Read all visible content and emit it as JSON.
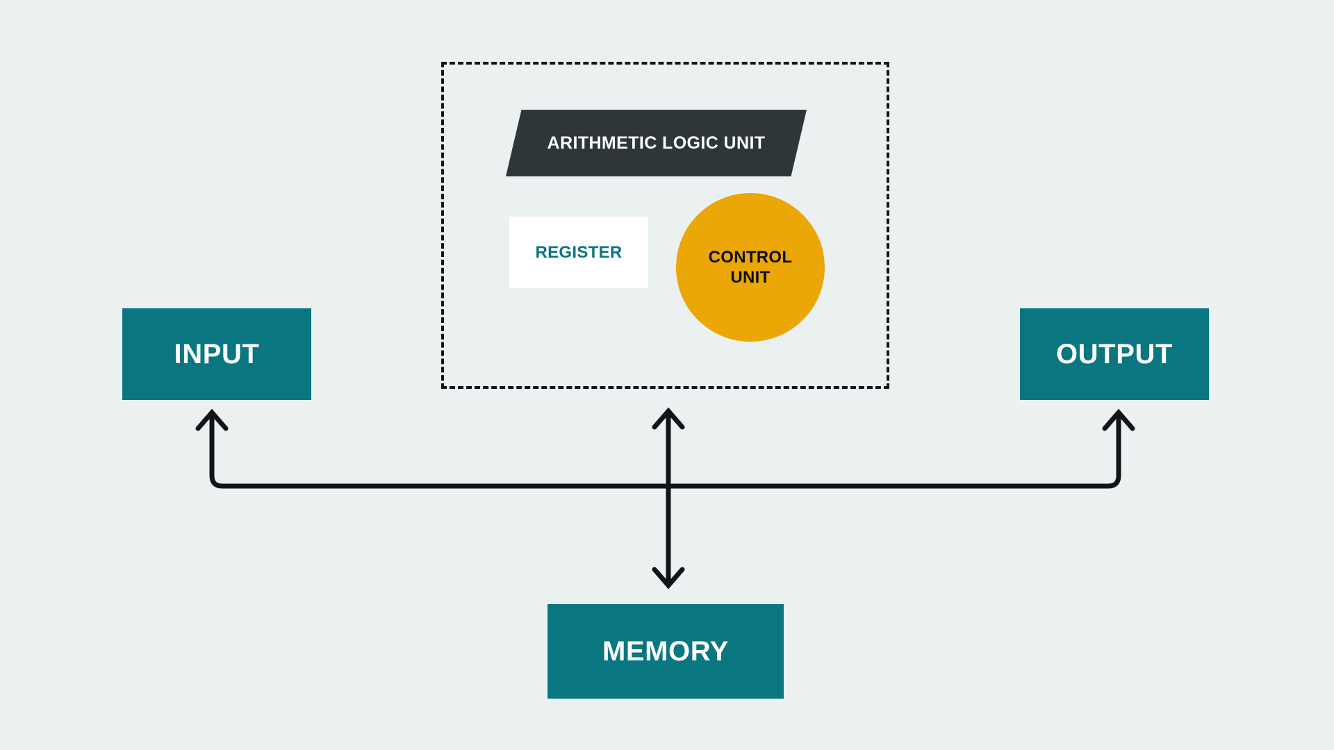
{
  "diagram": {
    "title": "Von Neumann computer architecture block diagram",
    "background_color": "#ebf1f1",
    "wire_color": "#111517"
  },
  "cpu": {
    "boundary_name": "central-processing-unit",
    "boundary_style": "dashed",
    "boundary_color": "#111517",
    "alu": {
      "label": "ARITHMETIC LOGIC UNIT",
      "shape": "trapezoid",
      "fill": "#2e3639",
      "text_color": "#ffffff"
    },
    "register": {
      "label": "REGISTER",
      "shape": "rectangle",
      "fill": "#ffffff",
      "text_color": "#0a7680"
    },
    "control_unit": {
      "label_line1": "CONTROL",
      "label_line2": "UNIT",
      "shape": "circle",
      "fill": "#eaa706",
      "text_color": "#0d0d0d"
    }
  },
  "blocks": {
    "input": {
      "label": "INPUT",
      "fill": "#0a7680",
      "text_color": "#ffffff"
    },
    "output": {
      "label": "OUTPUT",
      "fill": "#0a7680",
      "text_color": "#ffffff"
    },
    "memory": {
      "label": "MEMORY",
      "fill": "#0a7680",
      "text_color": "#ffffff"
    }
  },
  "connectors": {
    "input_bus": {
      "name": "bus-to-input",
      "direction": "up",
      "arrowheads": 1
    },
    "output_bus": {
      "name": "bus-to-output",
      "direction": "up",
      "arrowheads": 1
    },
    "memory_bus": {
      "name": "bus-cpu-memory",
      "direction": "bidirectional",
      "arrowheads": 2
    },
    "system_bus": {
      "name": "horizontal-system-bus",
      "direction": "none",
      "arrowheads": 0
    }
  }
}
